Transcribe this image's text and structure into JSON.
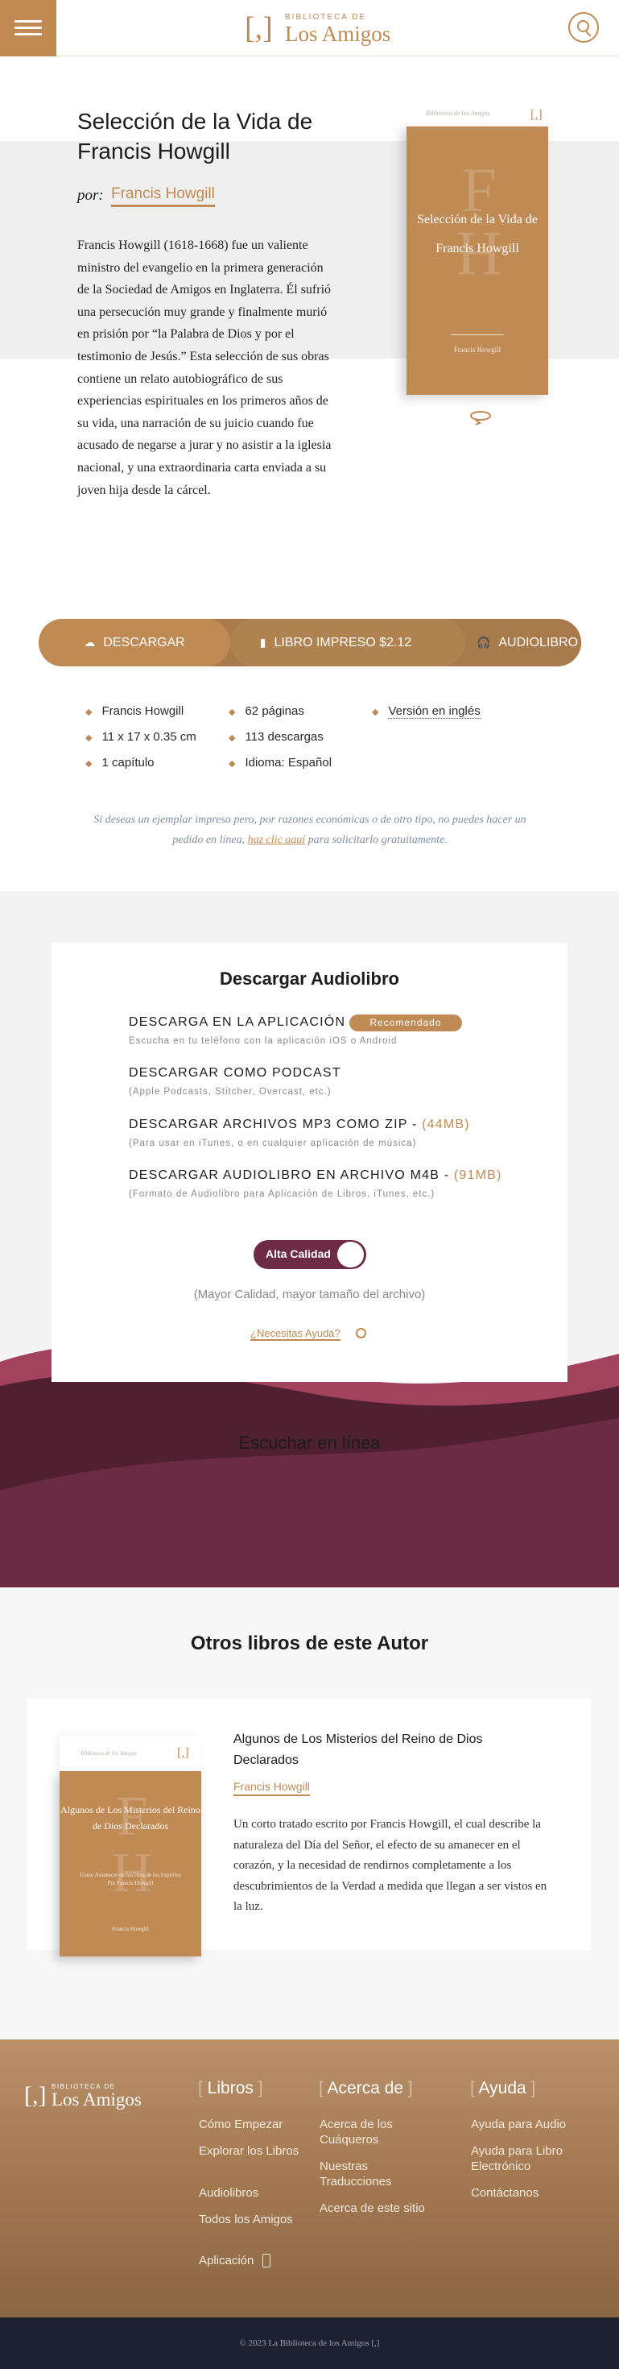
{
  "header": {
    "logo_top": "BIBLIOTECA DE",
    "logo_bottom": "Los Amigos",
    "logo_bracket": "[,]"
  },
  "book": {
    "title": "Selección de la Vida de Francis Howgill",
    "by_label": "por:",
    "author": "Francis Howgill",
    "description": "Francis Howgill (1618-1668) fue un valiente ministro del evangelio en la primera generación de la Sociedad de Amigos en Inglaterra. Él sufrió una persecución muy grande y finalmente murió en prisión por “la Palabra de Dios y por el testimonio de Jesús.” Esta selección de sus obras contiene un relato autobiográfico de sus experiencias espirituales en los primeros años de su vida, una narración de su juicio cuando fue acusado de negarse a jurar y no asistir a la iglesia nacional, y una extraordinaria carta enviada a su joven hija desde la cárcel.",
    "cover": {
      "strip_text": "Biblioteca de los Amigos",
      "bracket": "[,]",
      "monogram_1": "F",
      "monogram_2": "H",
      "title": "Selección de la Vida de Francis Howgill",
      "author": "Francis Howgill"
    }
  },
  "actions": {
    "download": "DESCARGAR",
    "print": "LIBRO IMPRESO $2.12",
    "audio": "AUDIOLIBRO"
  },
  "meta": {
    "col1": [
      "Francis Howgill",
      "11 x 17 x 0.35 cm",
      "1 capítulo"
    ],
    "col2": [
      "62 páginas",
      "113 descargas",
      "Idioma: Español"
    ],
    "col3": [
      "Versión en inglés"
    ]
  },
  "note": {
    "before": "Si deseas un ejemplar impreso pero, por razones económicas o de otro tipo, no puedes hacer un pedido en línea,",
    "link": "haz clic aquí",
    "after": "para solicitarlo gratuitamente."
  },
  "audiobook": {
    "title": "Descargar Audiolibro",
    "options": [
      {
        "label": "DESCARGA EN LA APLICACIÓN",
        "size": "",
        "sub": "Escucha en tu teléfono con la aplicación iOS o Android"
      },
      {
        "label": "DESCARGAR COMO PODCAST",
        "size": "",
        "sub": "(Apple Podcasts, Stitcher, Overcast, etc.)"
      },
      {
        "label": "DESCARGAR ARCHIVOS MP3 COMO ZIP - ",
        "size": "(44MB)",
        "sub": "(Para usar en iTunes, o en cualquier aplicación de música)"
      },
      {
        "label": "DESCARGAR AUDIOLIBRO EN ARCHIVO M4B - ",
        "size": "(91MB)",
        "sub": "(Formato de Audiolibro para Aplicación de Libros, iTunes, etc.)"
      }
    ],
    "recommended": "Recomendado",
    "quality_toggle": "Alta Calidad",
    "quality_note": "(Mayor Calidad, mayor tamaño del archivo)",
    "help": "¿Necesitas Ayuda?",
    "listen_online": "Escuchar en línea"
  },
  "other_books": {
    "title": "Otros libros de este Autor",
    "book": {
      "title": "Algunos de Los Misterios del Reino de Dios Declarados",
      "author": "Francis Howgill",
      "description": "Un corto tratado escrito por Francis Howgill, el cual describe la naturaleza del Día del Señor, el efecto de su amanecer en el corazón, y la necesidad de rendirnos completamente a los descubrimientos de la Verdad a medida que llegan a ser vistos en la luz.",
      "cover_strip": "Biblioteca de los Amigos",
      "cover_title": "Algunos de Los Misterios del Reino de Dios Declarados",
      "cover_subtitle": "Como Amanecer de los Ojos de los Espíritus Por Francis Howgill",
      "cover_author": "Francis Howgill"
    }
  },
  "footer": {
    "logo_top": "BIBLIOTECA DE",
    "logo_bottom": "Los Amigos",
    "col1_title": "Libros",
    "col1": [
      "Cómo Empezar",
      "Explorar los Libros",
      "Audiolibros",
      "Todos los Amigos",
      "Aplicación"
    ],
    "col2_title": "Acerca de",
    "col2": [
      "Acerca de los Cuáqueros",
      "Nuestras Traducciones",
      "Acerca de este sitio"
    ],
    "col3_title": "Ayuda",
    "col3": [
      "Ayuda para Audio",
      "Ayuda para Libro Electrónico",
      "Contáctanos"
    ],
    "copyright": "© 2023 La Biblioteca de los Amigos [,]"
  },
  "colors": {
    "accent": "#c08a55",
    "maroon": "#6d2b45",
    "footer_dark": "#1d2230"
  }
}
